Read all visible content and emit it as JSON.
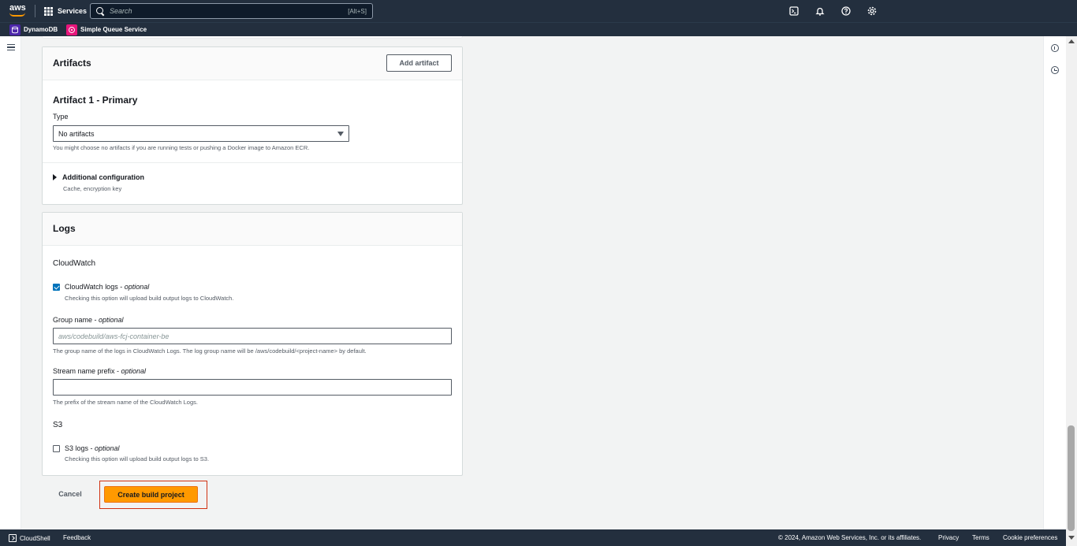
{
  "topnav": {
    "logo_text": "aws",
    "services_label": "Services",
    "search_placeholder": "Search",
    "search_shortcut": "[Alt+S]"
  },
  "favorites": [
    {
      "label": "DynamoDB",
      "color": "#4d27aa"
    },
    {
      "label": "Simple Queue Service",
      "color": "#e7157b"
    }
  ],
  "artifacts": {
    "title": "Artifacts",
    "add_button": "Add artifact",
    "artifact_title": "Artifact 1 - Primary",
    "type_label": "Type",
    "type_value": "No artifacts",
    "type_desc": "You might choose no artifacts if you are running tests or pushing a Docker image to Amazon ECR.",
    "additional_config": "Additional configuration",
    "additional_config_desc": "Cache, encryption key"
  },
  "logs": {
    "title": "Logs",
    "cloudwatch_section": "CloudWatch",
    "cloudwatch_logs_label": "CloudWatch logs - ",
    "optional": "optional",
    "cloudwatch_logs_desc": "Checking this option will upload build output logs to CloudWatch.",
    "cloudwatch_checked": true,
    "group_name_label": "Group name - ",
    "group_name_placeholder": "aws/codebuild/aws-fcj-container-be",
    "group_name_desc": "The group name of the logs in CloudWatch Logs. The log group name will be /aws/codebuild/<project-name> by default.",
    "stream_prefix_label": "Stream name prefix - ",
    "stream_prefix_value": "",
    "stream_prefix_desc": "The prefix of the stream name of the CloudWatch Logs.",
    "s3_section": "S3",
    "s3_logs_label": "S3 logs - ",
    "s3_logs_desc": "Checking this option will upload build output logs to S3.",
    "s3_checked": false
  },
  "actions": {
    "cancel": "Cancel",
    "create": "Create build project"
  },
  "footer": {
    "cloudshell": "CloudShell",
    "feedback": "Feedback",
    "copyright": "© 2024, Amazon Web Services, Inc. or its affiliates.",
    "privacy": "Privacy",
    "terms": "Terms",
    "cookies": "Cookie preferences"
  },
  "colors": {
    "nav_bg": "#232f3e",
    "primary_button": "#ff9900",
    "checkbox_checked": "#0073bb",
    "highlight_border": "#d13212"
  }
}
